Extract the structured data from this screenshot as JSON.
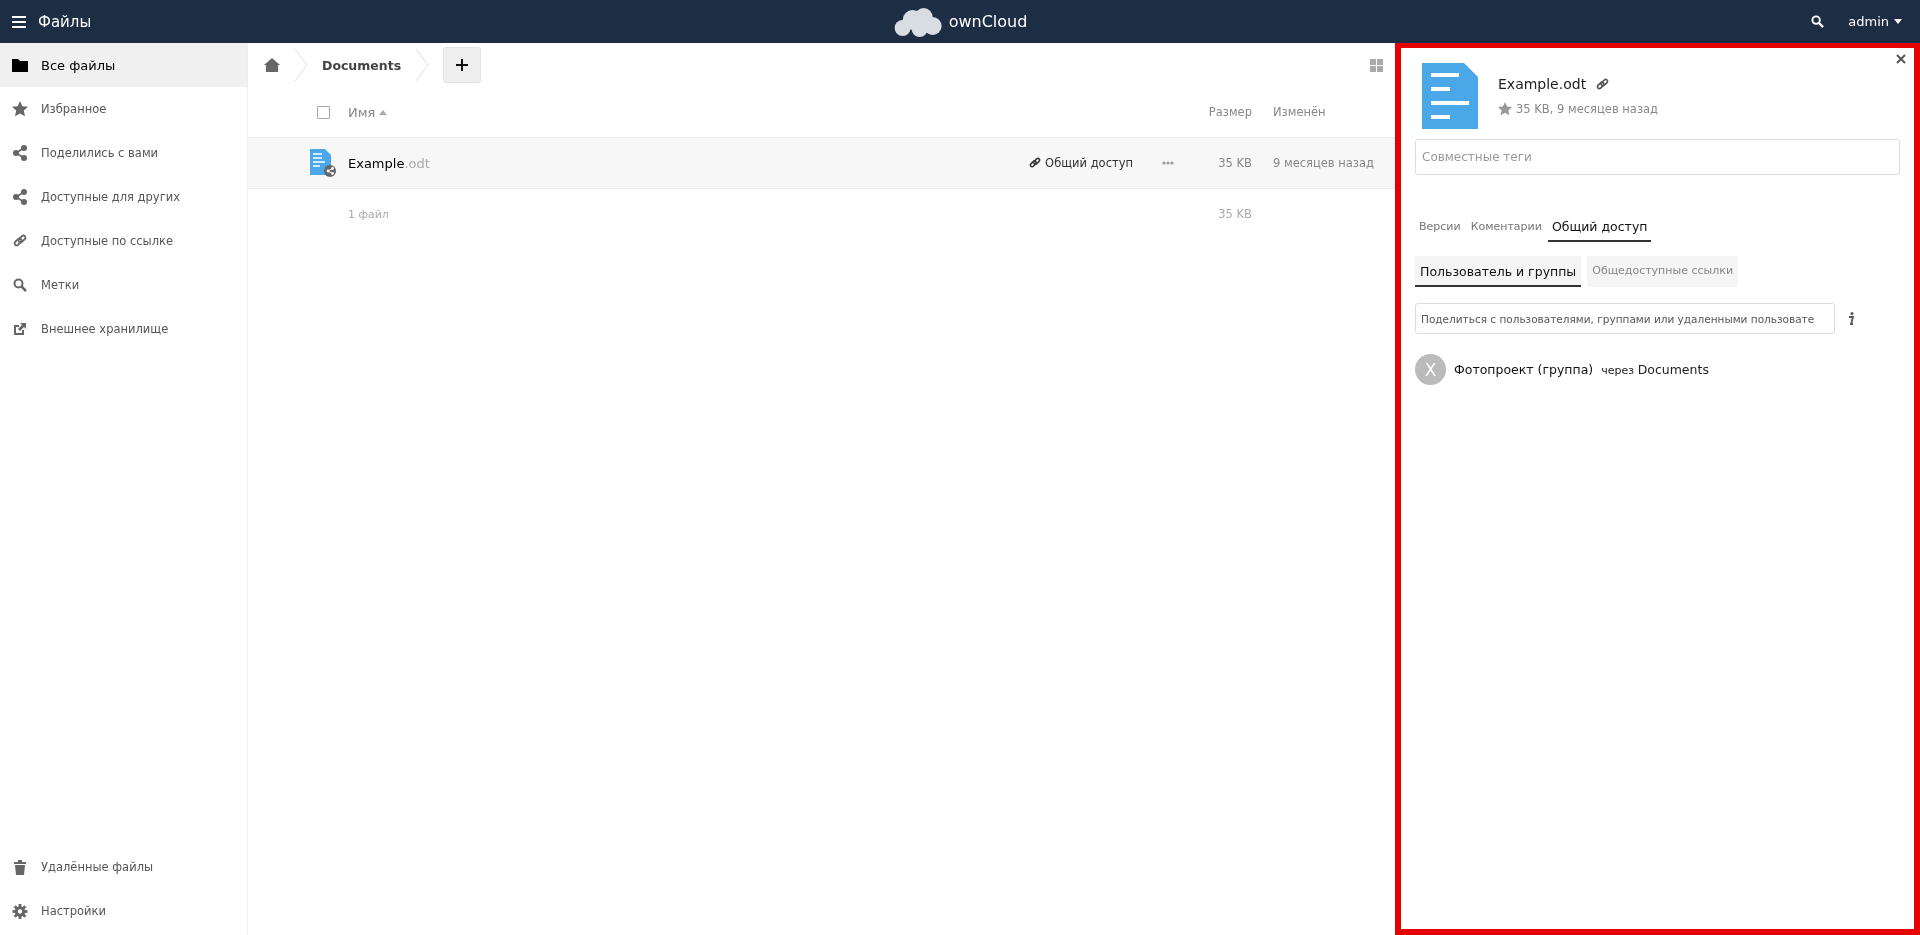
{
  "header": {
    "app_title": "Файлы",
    "logo_text": "ownCloud",
    "user": "admin"
  },
  "sidebar": {
    "items": [
      {
        "label": "Все файлы",
        "kind": "folder",
        "selected": true
      },
      {
        "label": "Избранное",
        "kind": "star",
        "selected": false
      },
      {
        "label": "Поделились с вами",
        "kind": "share",
        "selected": false
      },
      {
        "label": "Доступные для других",
        "kind": "share",
        "selected": false
      },
      {
        "label": "Доступные по ссылке",
        "kind": "link",
        "selected": false
      },
      {
        "label": "Метки",
        "kind": "search",
        "selected": false
      },
      {
        "label": "Внешнее хранилище",
        "kind": "external",
        "selected": false
      }
    ],
    "bottom_items": [
      {
        "label": "Удалённые файлы",
        "kind": "trash",
        "selected": false
      },
      {
        "label": "Настройки",
        "kind": "gear",
        "selected": false
      }
    ]
  },
  "breadcrumb": {
    "items": [
      "Documents"
    ]
  },
  "table": {
    "select_all_checked": false,
    "columns": {
      "name": "Имя",
      "size": "Размер",
      "modified": "Изменён"
    },
    "rows": [
      {
        "name": "Example",
        "extension": ".odt",
        "shared": true,
        "share_label": "Общий доступ",
        "size": "35 KB",
        "modified": "9 месяцев назад"
      }
    ],
    "footer": {
      "count": "1 файл",
      "size": "35 KB"
    }
  },
  "details": {
    "file_name": "Example.odt",
    "meta": "35 KB, 9 месяцев назад",
    "starred": false,
    "tags_placeholder": "Совместные теги",
    "tabs": [
      {
        "label": "Версии",
        "selected": false
      },
      {
        "label": "Коментарии",
        "selected": false
      },
      {
        "label": "Общий доступ",
        "selected": true
      }
    ],
    "subtabs": [
      {
        "label": "Пользователь и группы",
        "selected": true
      },
      {
        "label": "Общедоступные ссылки",
        "selected": false
      }
    ],
    "share_placeholder": "Поделиться с пользователями, группами или удаленными пользовате",
    "shares": [
      {
        "avatar_letter": "X",
        "name": "Фотопроект (группа)",
        "via": "через",
        "via_target": "Documents"
      }
    ]
  }
}
